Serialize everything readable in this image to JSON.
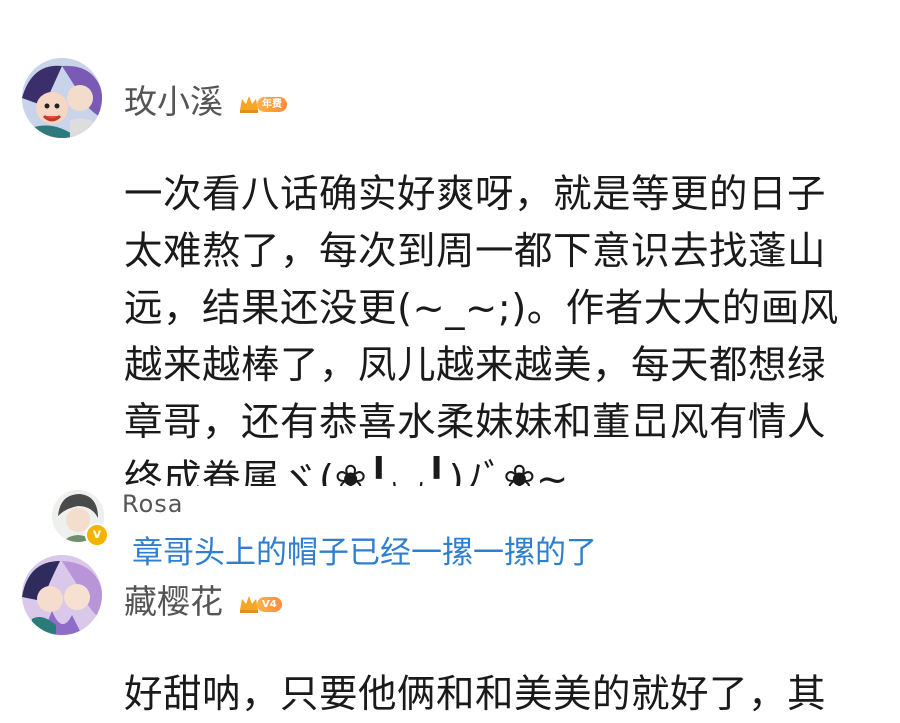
{
  "comments": [
    {
      "username": "玫小溪",
      "badge_label": "年费",
      "avatar_icon": "anime-couple-avatar",
      "text": "一次看八话确实好爽呀，就是等更的日子太难熬了，每次到周一都下意识去找蓬山远，结果还没更(~_~;)。作者大大的画风越来越棒了，凤儿越来越美，每天都想绿章哥，还有恭喜水柔妹妹和董旵风有情人终成眷属ヾ(❀╹◡╹)ﾉﾞ❀~",
      "reply": {
        "name": "Rosa",
        "verified_badge": "v",
        "text": "章哥头上的帽子已经一摞一摞的了"
      }
    },
    {
      "username": "藏樱花",
      "badge_label": "V4",
      "avatar_icon": "anime-couple-avatar",
      "text": "好甜呐，只要他俩和和美美的就好了，其"
    }
  ],
  "colors": {
    "username": "#555555",
    "reply_link": "#2f7fd1",
    "badge_orange": "#ff8b3d",
    "crown_gold": "#f5a623"
  }
}
